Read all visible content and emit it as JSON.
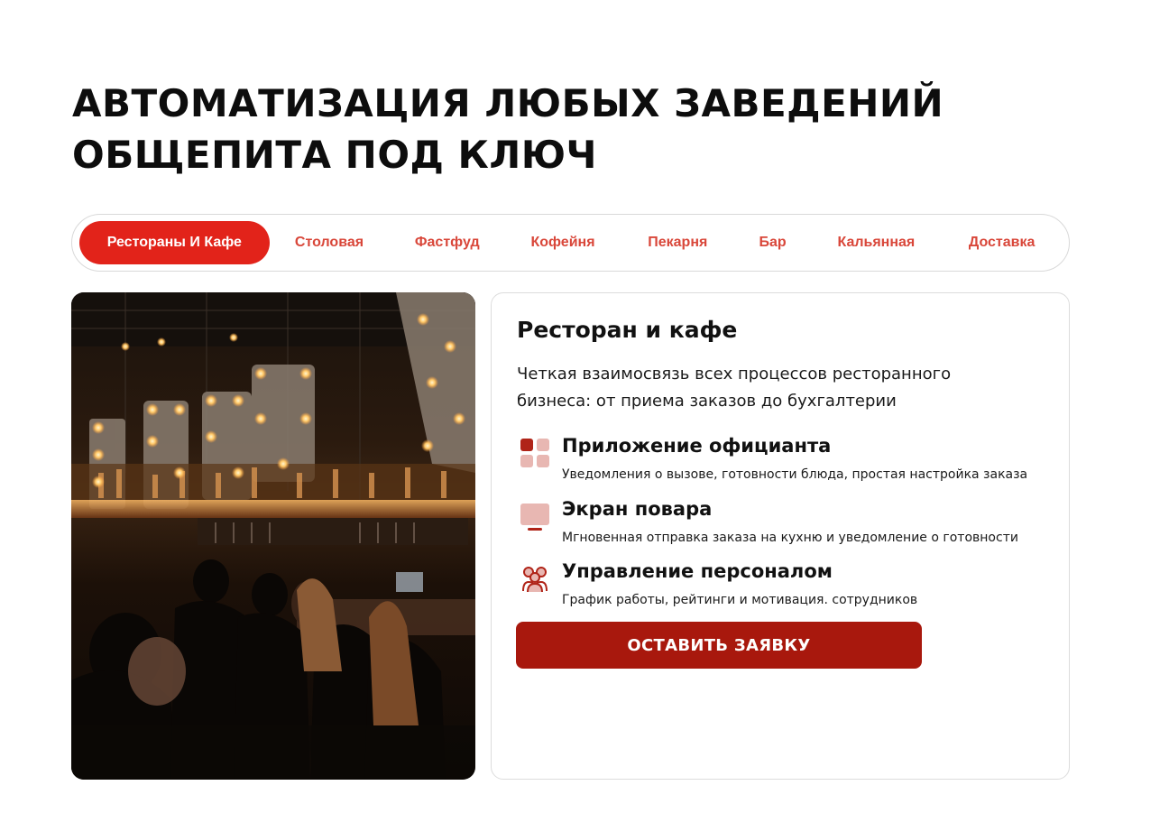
{
  "header": {
    "title_line1": "АВТОМАТИЗАЦИЯ ЛЮБЫХ ЗАВЕДЕНИЙ",
    "title_line2": "ОБЩЕПИТА ПОД КЛЮЧ"
  },
  "tabs": [
    {
      "label": "Рестораны И Кафе",
      "active": true
    },
    {
      "label": "Столовая",
      "active": false
    },
    {
      "label": "Фастфуд",
      "active": false
    },
    {
      "label": "Кофейня",
      "active": false
    },
    {
      "label": "Пекарня",
      "active": false
    },
    {
      "label": "Бар",
      "active": false
    },
    {
      "label": "Кальянная",
      "active": false
    },
    {
      "label": "Доставка",
      "active": false
    }
  ],
  "card": {
    "title": "Ресторан и кафе",
    "description": "Четкая взаимосвязь всех процессов ресторанного бизнеса: от приема заказов до бухгалтерии",
    "features": [
      {
        "icon": "apps-grid-icon",
        "title": "Приложение официанта",
        "text": "Уведомления о вызове, готовности блюда, простая настройка заказа"
      },
      {
        "icon": "monitor-icon",
        "title": "Экран повара",
        "text": "Мгновенная отправка заказа на кухню и уведомление о готовности"
      },
      {
        "icon": "people-group-icon",
        "title": "Управление персоналом",
        "text": "График работы, рейтинги и мотивация. сотрудников"
      }
    ],
    "cta_label": "ОСТАВИТЬ ЗАЯВКУ"
  },
  "colors": {
    "accent": "#e2231a",
    "tab_text": "#d9473a",
    "cta": "#a8180d",
    "icon_dark": "#b02418",
    "icon_light": "#e8b7b2"
  },
  "photo": {
    "alt": "restaurant-bar-interior"
  }
}
